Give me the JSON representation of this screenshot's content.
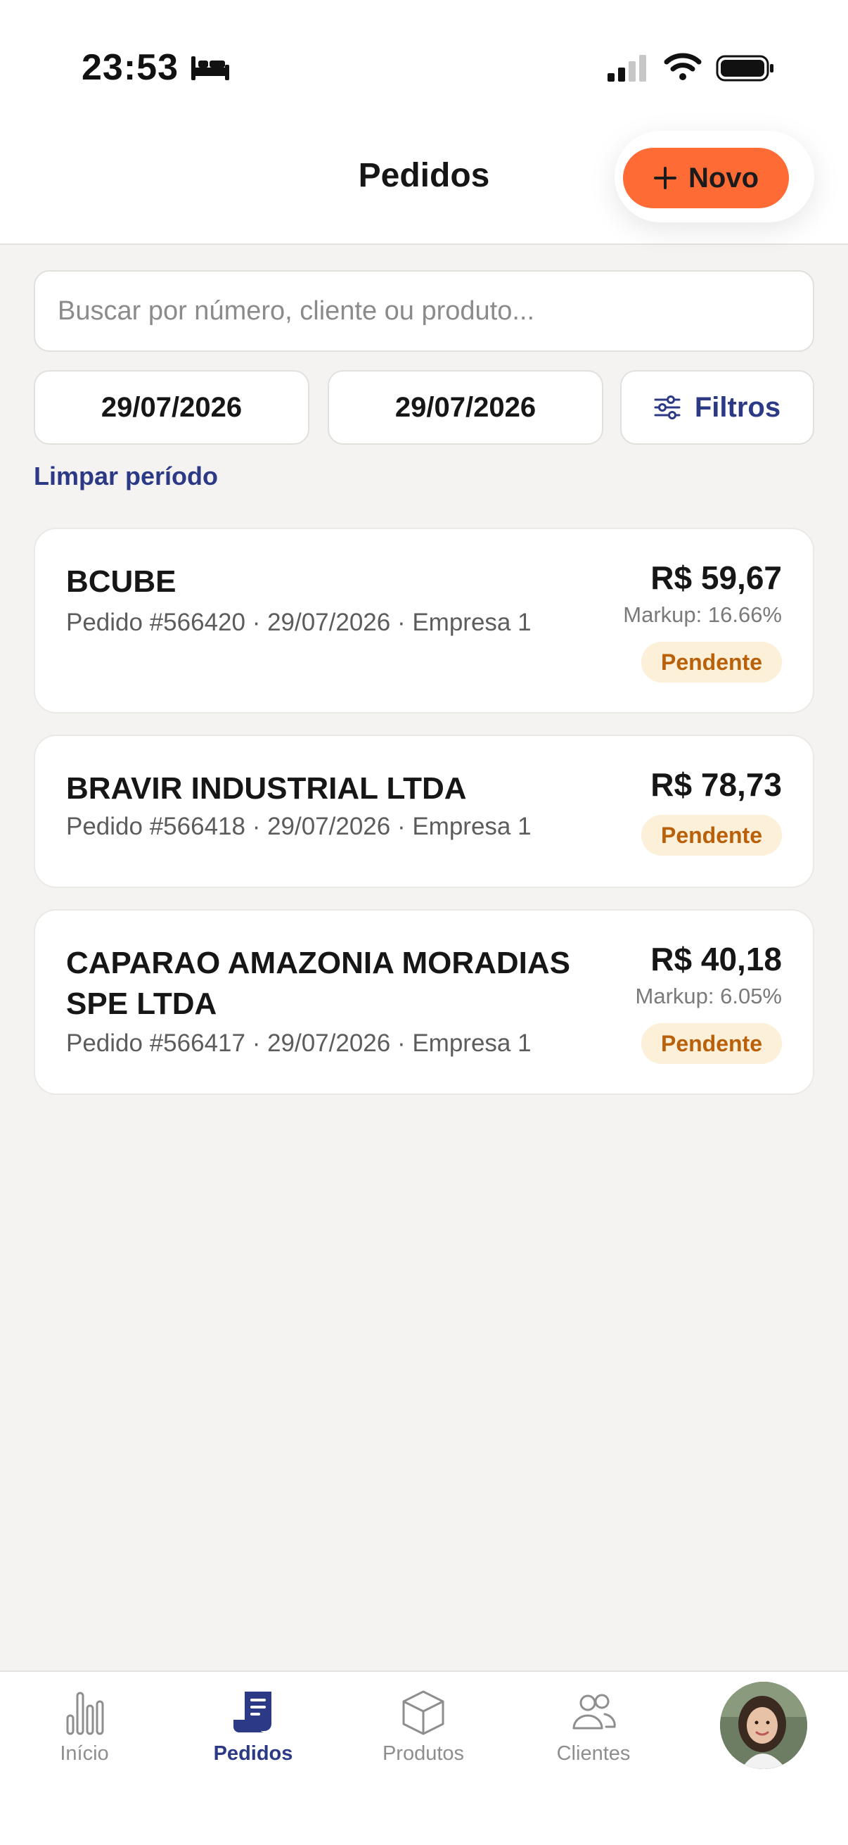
{
  "status_bar": {
    "time": "23:53",
    "icons": [
      "bed-icon",
      "cellular-signal-icon",
      "wifi-icon",
      "battery-icon"
    ]
  },
  "header": {
    "title": "Pedidos",
    "new_button_label": "Novo",
    "new_button_icon": "plus-icon",
    "accent_color": "#ff6b35"
  },
  "search": {
    "placeholder": "Buscar por número, cliente ou produto...",
    "value": ""
  },
  "filters": {
    "date_from": "29/07/2026",
    "date_to": "29/07/2026",
    "filters_label": "Filtros",
    "filters_icon": "sliders-icon",
    "clear_period_label": "Limpar período",
    "link_color": "#2c3a86"
  },
  "orders": [
    {
      "client": "BCUBE",
      "meta": "Pedido #566420 · 29/07/2026 · Empresa 1",
      "total": "R$ 59,67",
      "markup": "Markup: 16.66%",
      "status": "Pendente"
    },
    {
      "client": "BRAVIR INDUSTRIAL LTDA",
      "meta": "Pedido #566418 · 29/07/2026 · Empresa 1",
      "total": "R$ 78,73",
      "status": "Pendente"
    },
    {
      "client": "CAPARAO AMAZONIA MORADIAS SPE LTDA",
      "meta": "Pedido #566417 · 29/07/2026 · Empresa 1",
      "total": "R$ 40,18",
      "markup": "Markup: 6.05%",
      "status": "Pendente"
    }
  ],
  "status_colors": {
    "pendente_bg": "#fdf0d8",
    "pendente_text": "#b8600a"
  },
  "tabbar": {
    "tabs": [
      {
        "label": "Início",
        "icon": "bar-chart-icon",
        "active": false
      },
      {
        "label": "Pedidos",
        "icon": "receipt-icon",
        "active": true
      },
      {
        "label": "Produtos",
        "icon": "box-icon",
        "active": false
      },
      {
        "label": "Clientes",
        "icon": "users-icon",
        "active": false
      }
    ],
    "profile_icon": "avatar"
  }
}
